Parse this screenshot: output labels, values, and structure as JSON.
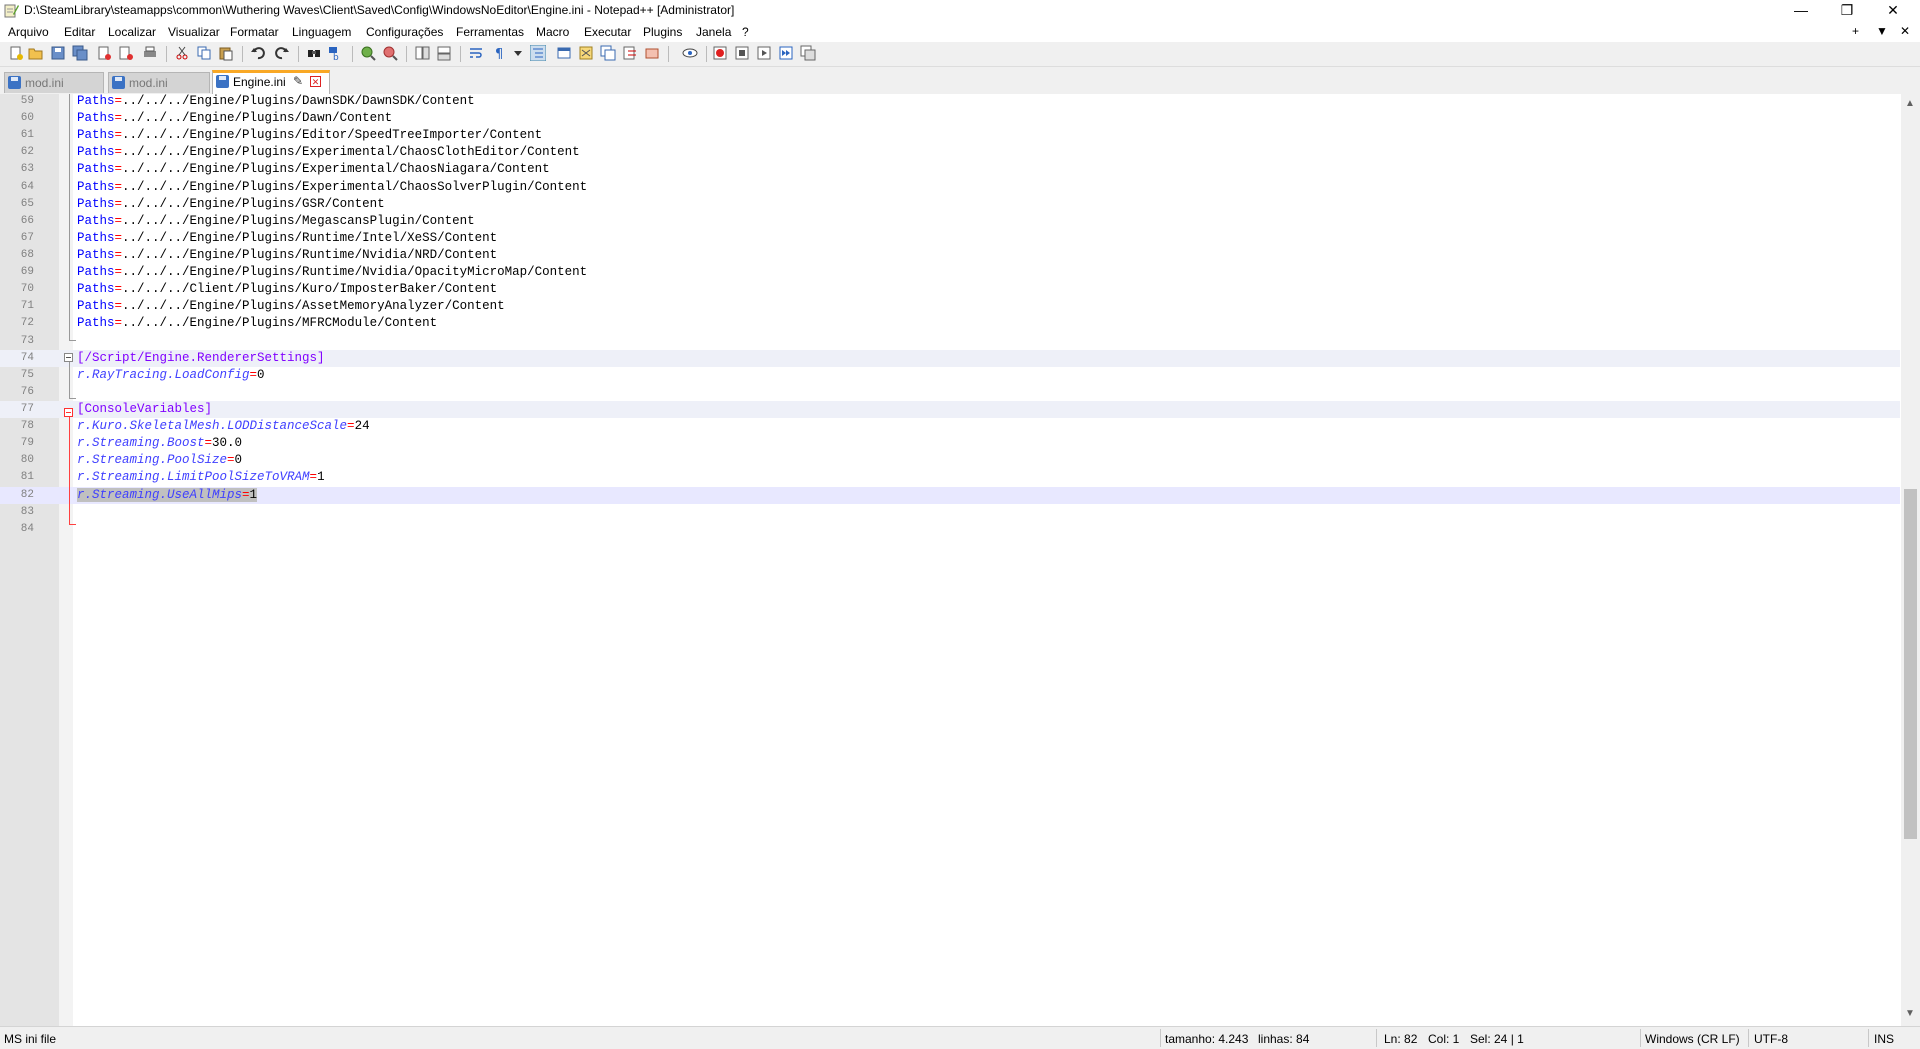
{
  "window": {
    "title": "D:\\SteamLibrary\\steamapps\\common\\Wuthering Waves\\Client\\Saved\\Config\\WindowsNoEditor\\Engine.ini - Notepad++ [Administrator]",
    "minimize": "—",
    "maximize": "❐",
    "close": "✕"
  },
  "menu": {
    "items": [
      "Arquivo",
      "Editar",
      "Localizar",
      "Visualizar",
      "Formatar",
      "Linguagem",
      "Configurações",
      "Ferramentas",
      "Macro",
      "Executar",
      "Plugins",
      "Janela",
      "?"
    ],
    "right": [
      "+",
      "▼",
      "✕"
    ]
  },
  "tabs": [
    {
      "label": "mod.ini",
      "active": false
    },
    {
      "label": "mod.ini",
      "active": false
    },
    {
      "label": "Engine.ini",
      "active": true
    }
  ],
  "editor": {
    "lines": [
      {
        "n": "59",
        "key": "Paths",
        "val": "../../../Engine/Plugins/DawnSDK/DawnSDK/Content"
      },
      {
        "n": "60",
        "key": "Paths",
        "val": "../../../Engine/Plugins/Dawn/Content"
      },
      {
        "n": "61",
        "key": "Paths",
        "val": "../../../Engine/Plugins/Editor/SpeedTreeImporter/Content"
      },
      {
        "n": "62",
        "key": "Paths",
        "val": "../../../Engine/Plugins/Experimental/ChaosClothEditor/Content"
      },
      {
        "n": "63",
        "key": "Paths",
        "val": "../../../Engine/Plugins/Experimental/ChaosNiagara/Content"
      },
      {
        "n": "64",
        "key": "Paths",
        "val": "../../../Engine/Plugins/Experimental/ChaosSolverPlugin/Content"
      },
      {
        "n": "65",
        "key": "Paths",
        "val": "../../../Engine/Plugins/GSR/Content"
      },
      {
        "n": "66",
        "key": "Paths",
        "val": "../../../Engine/Plugins/MegascansPlugin/Content"
      },
      {
        "n": "67",
        "key": "Paths",
        "val": "../../../Engine/Plugins/Runtime/Intel/XeSS/Content"
      },
      {
        "n": "68",
        "key": "Paths",
        "val": "../../../Engine/Plugins/Runtime/Nvidia/NRD/Content"
      },
      {
        "n": "69",
        "key": "Paths",
        "val": "../../../Engine/Plugins/Runtime/Nvidia/OpacityMicroMap/Content"
      },
      {
        "n": "70",
        "key": "Paths",
        "val": "../../../Client/Plugins/Kuro/ImposterBaker/Content"
      },
      {
        "n": "71",
        "key": "Paths",
        "val": "../../../Engine/Plugins/AssetMemoryAnalyzer/Content"
      },
      {
        "n": "72",
        "key": "Paths",
        "val": "../../../Engine/Plugins/MFRCModule/Content"
      },
      {
        "n": "73"
      },
      {
        "n": "74",
        "section": "[/Script/Engine.RendererSettings]"
      },
      {
        "n": "75",
        "ikey": "r.RayTracing.LoadConfig",
        "val": "0"
      },
      {
        "n": "76"
      },
      {
        "n": "77",
        "section": "[ConsoleVariables]"
      },
      {
        "n": "78",
        "ikey": "r.Kuro.SkeletalMesh.LODDistanceScale",
        "val": "24"
      },
      {
        "n": "79",
        "ikey": "r.Streaming.Boost",
        "val": "30.0"
      },
      {
        "n": "80",
        "ikey": "r.Streaming.PoolSize",
        "val": "0"
      },
      {
        "n": "81",
        "ikey": "r.Streaming.LimitPoolSizeToVRAM",
        "val": "1"
      },
      {
        "n": "82",
        "ikey": "r.Streaming.UseAllMips",
        "val": "1",
        "current": true
      },
      {
        "n": "83"
      },
      {
        "n": "84"
      }
    ]
  },
  "status": {
    "language": "MS ini file",
    "length": "tamanho: 4.243",
    "lines": "linhas: 84",
    "ln": "Ln: 82",
    "col": "Col: 1",
    "sel": "Sel: 24 | 1",
    "eol": "Windows (CR LF)",
    "encoding": "UTF-8",
    "mode": "INS"
  }
}
